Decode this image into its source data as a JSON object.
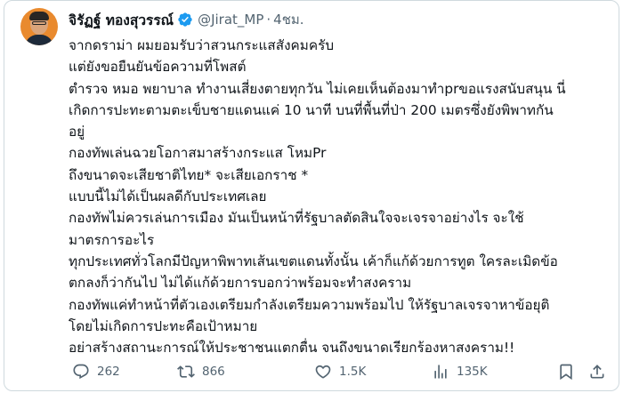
{
  "author": {
    "name": "จิรัฏฐ์ ทองสุวรรณ์",
    "handle": "@Jirat_MP",
    "separator": "·",
    "time": "4ชม."
  },
  "body_lines": [
    "จากดราม่า ผมยอมรับว่าสวนกระแสสังคมครับ",
    "แต่ยังขอยืนยันข้อความที่โพสต์",
    "ตำรวจ หมอ พยาบาล ทำงานเสี่ยงตายทุกวัน ไม่เคยเห็นต้องมาทำprขอแรงสนับสนุน นี่",
    "เกิดการปะทะตามตะเข็บชายแดนแค่ 10 นาที บนที่พื้นที่ป่า 200 เมตรซึ่งยังพิพาทกัน",
    "อยู่",
    "กองทัพเล่นฉวยโอกาสมาสร้างกระแส โหมPr",
    "ถึงขนาดจะเสียชาติไทย* จะเสียเอกราช *",
    "แบบนี้ไม่ได้เป็นผลดีกับประเทศเลย",
    "กองทัพไม่ควรเล่นการเมือง มันเป็นหน้าที่รัฐบาลตัดสินใจจะเจรจาอย่างไร จะใช้",
    "มาตรการอะไร",
    "ทุกประเทศทั่วโลกมีปัญหาพิพาทเส้นเขตแดนทั้งนั้น เค้าก็แก้ด้วยการทูต ใครละเมิดข้อ",
    "ตกลงก็ว่ากันไป ไม่ได้แก้ด้วยการบอกว่าพร้อมจะทำสงคราม",
    "กองทัพแค่ทำหน้าที่ตัวเองเตรียมกำลังเตรียมความพร้อมไป ให้รัฐบาลเจรจาหาข้อยุติ",
    "โดยไม่เกิดการปะทะคือเป้าหมาย",
    "อย่าสร้างสถานะการณ์ให้ประชาชนแตกตื่น จนถึงขนาดเรียกร้องหาสงคราม!!"
  ],
  "metrics": {
    "replies": "262",
    "reposts": "866",
    "likes": "1.5K",
    "views": "135K"
  },
  "colors": {
    "verified": "#1d9bf0",
    "secondary_text": "#536471",
    "border": "#cfd9de"
  },
  "icons": {
    "reply": "speech-bubble",
    "repost": "retweet-arrows",
    "like": "heart",
    "views": "bar-chart",
    "bookmark": "bookmark",
    "share": "upload-arrow"
  }
}
